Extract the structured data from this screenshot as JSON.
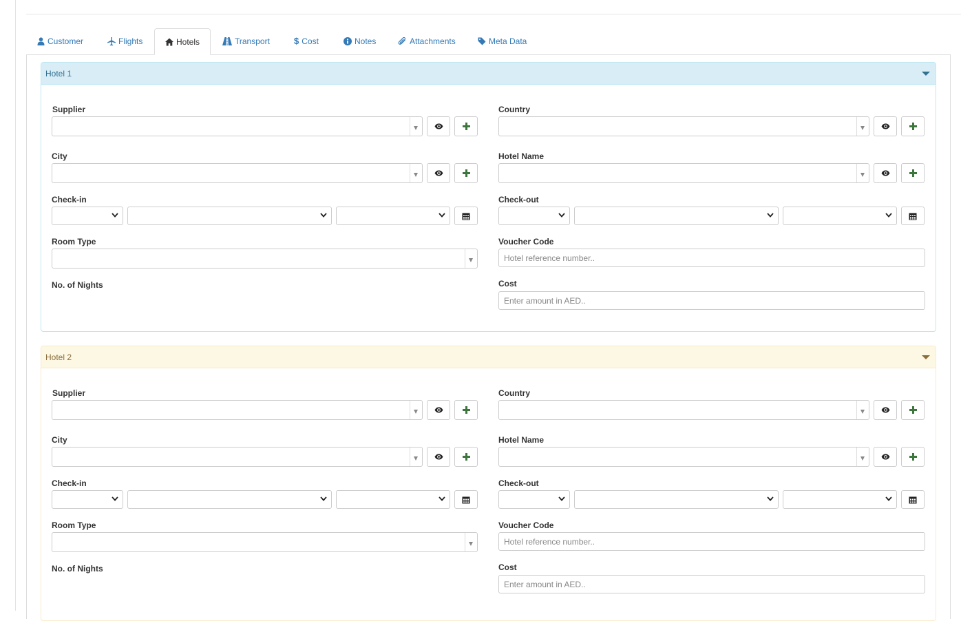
{
  "tabs": [
    {
      "label": "Customer",
      "icon": "user-icon"
    },
    {
      "label": "Flights",
      "icon": "plane-icon"
    },
    {
      "label": "Hotels",
      "icon": "home-icon",
      "active": true
    },
    {
      "label": "Transport",
      "icon": "road-icon"
    },
    {
      "label": "Cost",
      "icon": "dollar-icon"
    },
    {
      "label": "Notes",
      "icon": "info-circle-icon"
    },
    {
      "label": "Attachments",
      "icon": "paperclip-icon"
    },
    {
      "label": "Meta Data",
      "icon": "tag-icon"
    }
  ],
  "hotels": [
    {
      "title": "Hotel 1",
      "labels": {
        "supplier": "Supplier",
        "country": "Country",
        "city": "City",
        "hotel_name": "Hotel Name",
        "check_in": "Check-in",
        "check_out": "Check-out",
        "room_type": "Room Type",
        "voucher_code": "Voucher Code",
        "nights": "No. of Nights",
        "cost": "Cost"
      },
      "voucher_placeholder": "Hotel reference number..",
      "cost_placeholder": "Enter amount in AED.."
    },
    {
      "title": "Hotel 2",
      "labels": {
        "supplier": "Supplier",
        "country": "Country",
        "city": "City",
        "hotel_name": "Hotel Name",
        "check_in": "Check-in",
        "check_out": "Check-out",
        "room_type": "Room Type",
        "voucher_code": "Voucher Code",
        "nights": "No. of Nights",
        "cost": "Cost"
      },
      "voucher_placeholder": "Hotel reference number..",
      "cost_placeholder": "Enter amount in AED.."
    }
  ],
  "colors": {
    "link": "#337ab7",
    "info_heading_bg": "#d9edf7",
    "warning_heading_bg": "#fcf8e3",
    "plus_green": "#3c763d"
  }
}
